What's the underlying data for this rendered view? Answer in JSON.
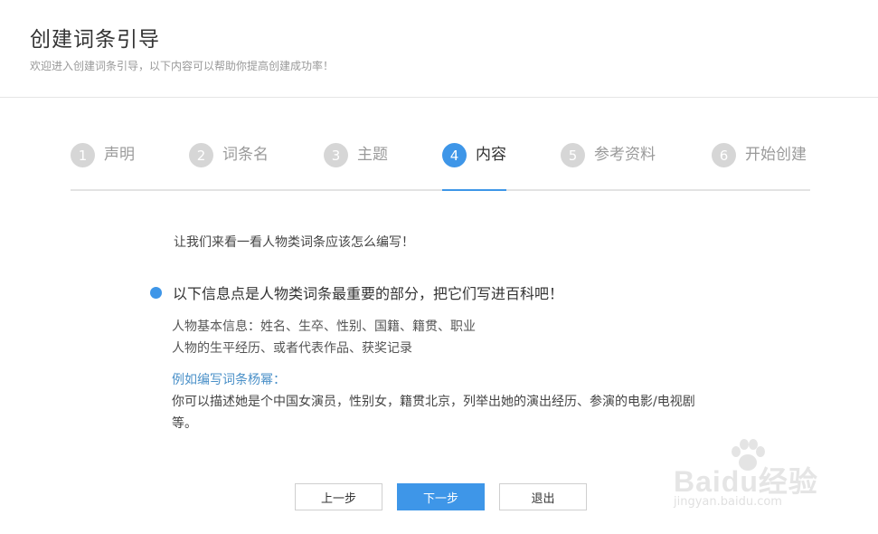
{
  "header": {
    "title": "创建词条引导",
    "subtitle": "欢迎进入创建词条引导，以下内容可以帮助你提高创建成功率！"
  },
  "steps": [
    {
      "num": "1",
      "label": "声明",
      "active": false
    },
    {
      "num": "2",
      "label": "词条名",
      "active": false
    },
    {
      "num": "3",
      "label": "主题",
      "active": false
    },
    {
      "num": "4",
      "label": "内容",
      "active": true
    },
    {
      "num": "5",
      "label": "参考资料",
      "active": false
    },
    {
      "num": "6",
      "label": "开始创建",
      "active": false
    }
  ],
  "content": {
    "intro": "让我们来看一看人物类词条应该怎么编写！",
    "point": "以下信息点是人物类词条最重要的部分，把它们写进百科吧！",
    "info_lines": [
      "人物基本信息：姓名、生卒、性别、国籍、籍贯、职业",
      "人物的生平经历、或者代表作品、获奖记录"
    ],
    "example_label": "例如编写词条杨幂：",
    "example_body": "你可以描述她是个中国女演员，性别女，籍贯北京，列举出她的演出经历、参演的电影/电视剧等。"
  },
  "buttons": {
    "prev": "上一步",
    "next": "下一步",
    "exit": "退出"
  },
  "watermark": {
    "logo": "Baidu经验",
    "url": "jingyan.baidu.com"
  },
  "colors": {
    "accent": "#3e96e8",
    "inactive_step": "#d6d6d6",
    "example_label": "#4a90c8"
  }
}
